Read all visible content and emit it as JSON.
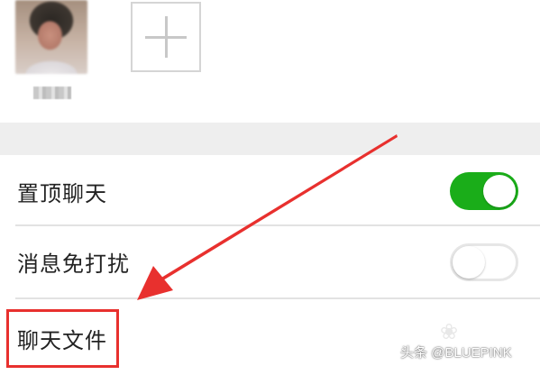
{
  "members": {
    "items": [
      {
        "name": "",
        "avatar": "blurred-photo"
      }
    ],
    "add_icon": "plus-icon"
  },
  "settings": {
    "rows": [
      {
        "label": "置顶聊天",
        "toggle": true
      },
      {
        "label": "消息免打扰",
        "toggle": false
      },
      {
        "label": "聊天文件"
      }
    ]
  },
  "colors": {
    "toggle_on": "#1aad19",
    "arrow": "#e8302e",
    "section_gap": "#eeeeee"
  },
  "watermark": {
    "text": "头条 @BLUEPINK",
    "logo_icon": "paw-icon"
  }
}
